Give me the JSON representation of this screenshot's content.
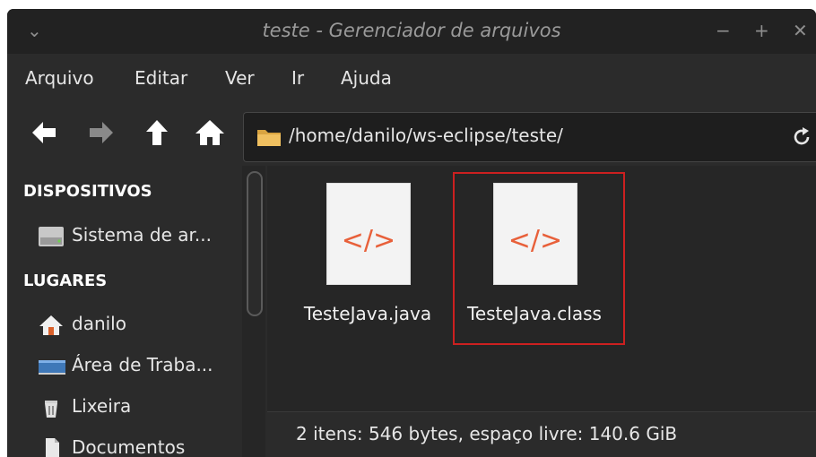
{
  "window": {
    "title": "teste - Gerenciador de arquivos"
  },
  "titlebar_buttons": {
    "menu": "⌄",
    "minimize": "−",
    "maximize": "+",
    "close": "✕"
  },
  "menu": [
    "Arquivo",
    "Editar",
    "Ver",
    "Ir",
    "Ajuda"
  ],
  "toolbar": {
    "back_icon": "arrow-left-icon",
    "forward_icon": "arrow-right-icon",
    "up_icon": "arrow-up-icon",
    "home_icon": "home-icon",
    "path": "/home/danilo/ws-eclipse/teste/",
    "reload_icon": "reload-icon"
  },
  "sidebar": {
    "devices_header": "DISPOSITIVOS",
    "devices": [
      {
        "label": "Sistema de ar...",
        "icon": "drive-icon"
      }
    ],
    "places_header": "LUGARES",
    "places": [
      {
        "label": "danilo",
        "icon": "home-icon"
      },
      {
        "label": "Área de Traba...",
        "icon": "desktop-icon"
      },
      {
        "label": "Lixeira",
        "icon": "trash-icon"
      },
      {
        "label": "Documentos",
        "icon": "document-icon"
      }
    ]
  },
  "files": [
    {
      "name": "TesteJava.java",
      "icon_text": "</>",
      "highlighted": false
    },
    {
      "name": "TesteJava.class",
      "icon_text": "</>",
      "highlighted": true
    }
  ],
  "status": "2 itens: 546 bytes, espaço livre: 140.6 GiB",
  "colors": {
    "accent_code": "#e8603a",
    "highlight": "#cc2020",
    "window_bg": "#2b2b2b"
  }
}
